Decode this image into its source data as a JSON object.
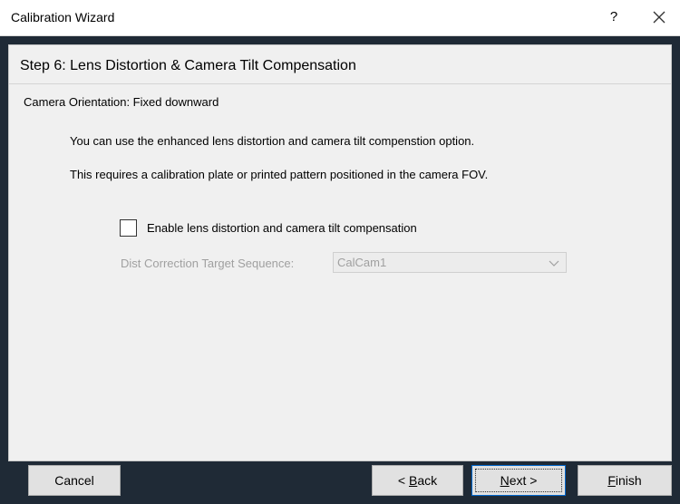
{
  "window": {
    "title": "Calibration Wizard",
    "help_label": "?",
    "close_label": "✕"
  },
  "step": {
    "title": "Step 6: Lens Distortion & Camera Tilt Compensation",
    "orientation": "Camera Orientation: Fixed downward",
    "description_1": "You can use the enhanced lens distortion and camera tilt compenstion option.",
    "description_2": "This requires a calibration plate or printed pattern positioned in the camera FOV."
  },
  "options": {
    "enable_label": "Enable lens distortion and camera tilt compensation",
    "enable_checked": false,
    "target_label": "Dist Correction Target Sequence:",
    "target_value": "CalCam1",
    "target_enabled": false
  },
  "buttons": {
    "cancel": "Cancel",
    "back_prefix": "< ",
    "back_mnemonic": "B",
    "back_rest": "ack",
    "next_mnemonic": "N",
    "next_rest": "ext >",
    "finish_mnemonic": "F",
    "finish_rest": "inish"
  }
}
